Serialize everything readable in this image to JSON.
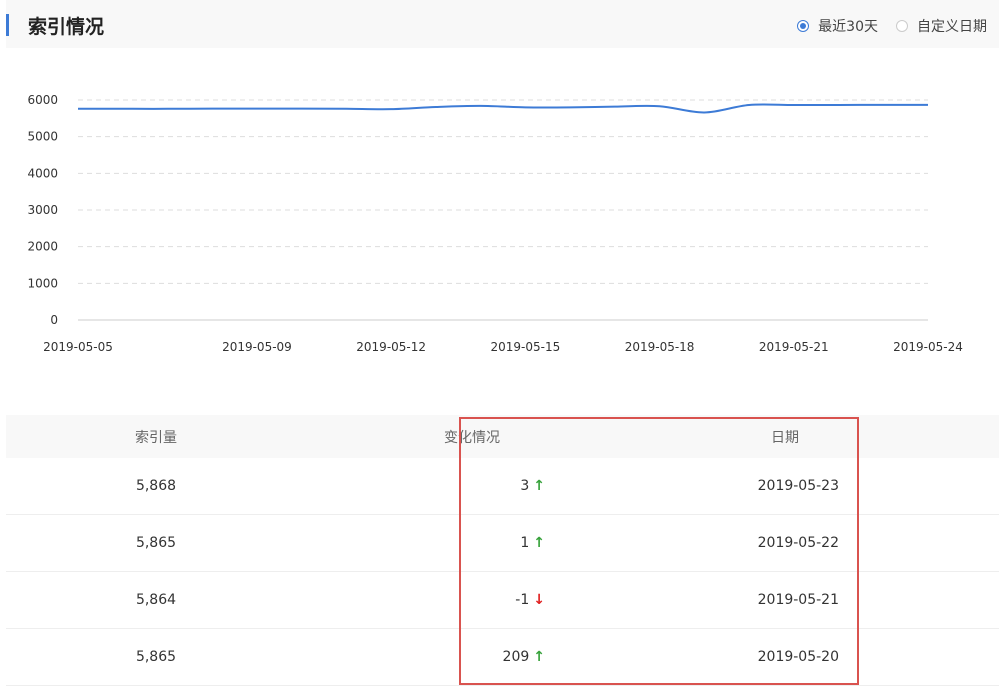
{
  "header": {
    "title": "索引情况"
  },
  "range_options": [
    {
      "label": "最近30天",
      "selected": true
    },
    {
      "label": "自定义日期",
      "selected": false
    }
  ],
  "colors": {
    "accent": "#3d7bd6",
    "up": "#37a23b",
    "down": "#e02020",
    "highlight_border": "#d9534f"
  },
  "chart_data": {
    "type": "line",
    "x_tick_labels": [
      "2019-05-05",
      "2019-05-09",
      "2019-05-12",
      "2019-05-15",
      "2019-05-18",
      "2019-05-21",
      "2019-05-24"
    ],
    "x": [
      "2019-05-05",
      "2019-05-06",
      "2019-05-07",
      "2019-05-08",
      "2019-05-09",
      "2019-05-10",
      "2019-05-11",
      "2019-05-12",
      "2019-05-13",
      "2019-05-14",
      "2019-05-15",
      "2019-05-16",
      "2019-05-17",
      "2019-05-18",
      "2019-05-19",
      "2019-05-20",
      "2019-05-21",
      "2019-05-22",
      "2019-05-23",
      "2019-05-24"
    ],
    "y": [
      5760,
      5760,
      5760,
      5765,
      5765,
      5765,
      5760,
      5750,
      5810,
      5840,
      5800,
      5800,
      5820,
      5830,
      5660,
      5865,
      5864,
      5865,
      5868,
      5868
    ],
    "ylim": [
      0,
      6000
    ],
    "y_ticks": [
      "0",
      "1000",
      "2000",
      "3000",
      "4000",
      "5000",
      "6000"
    ],
    "grid": true,
    "line_color": "#3d7bd6"
  },
  "table": {
    "headers": {
      "count": "索引量",
      "change": "变化情况",
      "date": "日期"
    },
    "rows": [
      {
        "count": "5,868",
        "change": "3",
        "direction": "up",
        "date": "2019-05-23"
      },
      {
        "count": "5,865",
        "change": "1",
        "direction": "up",
        "date": "2019-05-22"
      },
      {
        "count": "5,864",
        "change": "-1",
        "direction": "down",
        "date": "2019-05-21"
      },
      {
        "count": "5,865",
        "change": "209",
        "direction": "up",
        "date": "2019-05-20"
      }
    ]
  }
}
